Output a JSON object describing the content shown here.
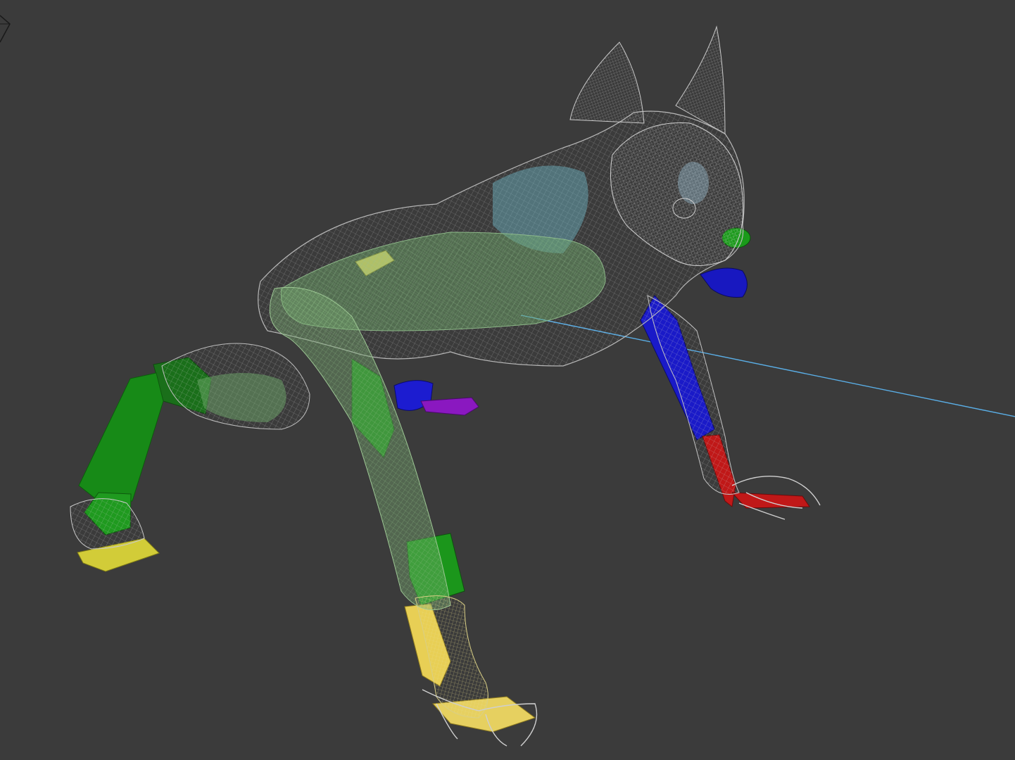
{
  "viewport": {
    "background": "#3b3b3b",
    "axis_gizmo_icon": "view-cube-icon"
  },
  "colors": {
    "wireframe": "#c8c8c8",
    "skin_green": "#7fb07a",
    "bone_green": "#1e8f1e",
    "bone_blue": "#1818c8",
    "bone_yellow": "#e2d36b",
    "bone_red": "#c81818",
    "bone_purple": "#8a1ec8",
    "bone_cyan": "#6fb8c8",
    "target_line": "#5aaee6"
  }
}
